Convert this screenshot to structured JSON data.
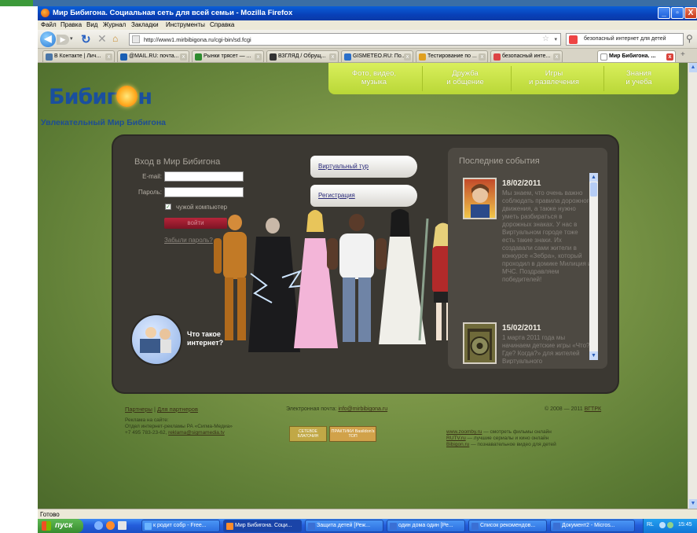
{
  "window": {
    "title": "Мир Бибигона. Социальная сеть для всей семьи - Mozilla Firefox",
    "buttons": [
      "_",
      "▫",
      "X"
    ]
  },
  "menu": [
    "Файл",
    "Правка",
    "Вид",
    "Журнал",
    "Закладки",
    "Инструменты",
    "Справка"
  ],
  "navbar": {
    "url": "http://www1.mirbibigona.ru/cgi-bin/sd.fcgi",
    "search_value": "безопасный интернет для детей"
  },
  "tabs": [
    {
      "label": "В Контакте | Лич...",
      "color": "#4a76a8"
    },
    {
      "label": "@MAIL.RU: почта...",
      "color": "#1a5fb4"
    },
    {
      "label": "Рынки трясет — ...",
      "color": "#2e8b2e"
    },
    {
      "label": "ВЗГЛЯД / Обрущ...",
      "color": "#333333"
    },
    {
      "label": "GISMETEO.RU: По...",
      "color": "#2a6fc9"
    },
    {
      "label": "Тестирование по ...",
      "color": "#e0a020"
    },
    {
      "label": "безопасный инте...",
      "color": "#d44"
    },
    {
      "label": "Мир Бибигона. ...",
      "color": "#ffffff"
    }
  ],
  "site": {
    "logo_left": "Бибиг",
    "logo_right": "н",
    "tagline": "Увлекательный Мир Бибигона",
    "nav": [
      {
        "line1": "Фото, видео,",
        "line2": "музыка"
      },
      {
        "line1": "Дружба",
        "line2": "и общение"
      },
      {
        "line1": "Игры",
        "line2": "и развлечения"
      },
      {
        "line1": "Знания",
        "line2": "и учеба"
      }
    ]
  },
  "login": {
    "title": "Вход в Мир Бибигона",
    "email_label": "E-mail:",
    "password_label": "Пароль:",
    "checkbox_label": "чужой компьютер",
    "enter_button": "войти",
    "forgot_link": "Забыли пароль?"
  },
  "actions": {
    "tour": "Виртуальный тур",
    "register": "Регистрация"
  },
  "internet": {
    "line1": "Что такое",
    "line2": "интернет?"
  },
  "events": {
    "title": "Последние события",
    "items": [
      {
        "date": "18/02/2011",
        "text": "Мы знаем, что очень важно соблюдать правила дорожного движения, а также нужно уметь разбираться в дорожных знаках. У нас в Виртуальном городе тоже есть такие знаки. Их создавали сами жители в конкурсе «Зебра», который проходил в домике Милиция и МЧС. Поздравляем победителей!"
      },
      {
        "date": "15/02/2011",
        "text": "1 марта 2011 года мы начинаем детские игры «Что? Где? Когда?» для жителей Виртуального"
      }
    ]
  },
  "footer": {
    "partners": "Партнеры",
    "for_partners": "Для партнеров",
    "ad_line1": "Реклама на сайте:",
    "ad_line2": "Отдел интернет-рекламы РА «Сигма-Медиа»",
    "ad_line3_prefix": "+7 495 783-23-62,",
    "ad_email": "reklama@sigmamedia.tv",
    "email_label": "Электронная почта:",
    "email_value": "info@mirbibigona.ru",
    "copyright_prefix": "© 2008 — 2011",
    "copyright_link": "ВГТРК",
    "badge1": "СЕТЕВОЕ БЛАГОЧИН",
    "badge2": "ПРАКТИКИ Basildon's ТОП",
    "links": [
      {
        "site": "www.zoomby.ru",
        "desc": "— смотреть фильмы онлайн"
      },
      {
        "site": "RUTV.ru",
        "desc": "— лучшие сериалы и кино онлайн"
      },
      {
        "site": "Bibigon.ru",
        "desc": "— познавательное видео для детей"
      }
    ]
  },
  "status": "Готово",
  "taskbar": {
    "start": "пуск",
    "tasks": [
      {
        "label": "к родит собр - Free...",
        "active": false
      },
      {
        "label": "Мир Бибигона. Соци...",
        "active": true
      },
      {
        "label": "Защита детей [Реж...",
        "active": false
      },
      {
        "label": "один дома один [Ре...",
        "active": false
      },
      {
        "label": "Список рекомендов...",
        "active": false
      },
      {
        "label": "Документ2 - Micros...",
        "active": false
      }
    ],
    "lang": "RL",
    "time": "15:45"
  }
}
